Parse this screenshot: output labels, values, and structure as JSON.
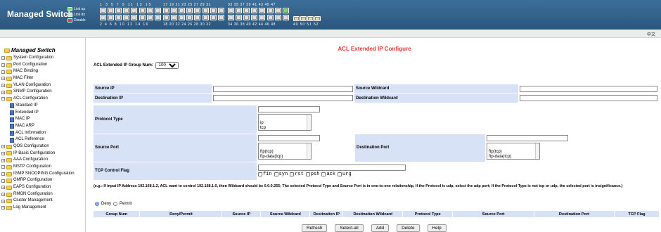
{
  "header": {
    "title": "Managed Switch",
    "legend": [
      {
        "label": "Link up",
        "color": "#7fd36f"
      },
      {
        "label": "Link dn",
        "color": "#dddddd"
      },
      {
        "label": "Disable",
        "color": "#e23b3b"
      }
    ],
    "top_numbers": [
      "1 3 5 7 9 11 13 15",
      "17 19 21 23 25 27 29 31",
      "33 35 37 39 41 43 45 47"
    ],
    "bottom_numbers": [
      "2 4 6 8 10 12 14 16",
      "18 20 22 24 26 28 30 32",
      "34 36 38 40 42 44 46 48",
      "49 50 51 52"
    ],
    "language": "中文"
  },
  "sidebar": {
    "title": "Managed Switch",
    "items": [
      {
        "label": "System Configuration",
        "type": "folder"
      },
      {
        "label": "Port Configuration",
        "type": "folder"
      },
      {
        "label": "MAC Binding",
        "type": "folder"
      },
      {
        "label": "MAC Filter",
        "type": "folder"
      },
      {
        "label": "VLAN Configuration",
        "type": "folder"
      },
      {
        "label": "SNMP Configuration",
        "type": "folder"
      },
      {
        "label": "ACL Configuration",
        "type": "folder-open"
      },
      {
        "label": "Standard IP",
        "type": "page"
      },
      {
        "label": "Extended IP",
        "type": "page"
      },
      {
        "label": "MAC IP",
        "type": "page"
      },
      {
        "label": "MAC ARP",
        "type": "page"
      },
      {
        "label": "ACL Information",
        "type": "page"
      },
      {
        "label": "ACL Reference",
        "type": "page"
      },
      {
        "label": "QOS Configuration",
        "type": "folder"
      },
      {
        "label": "IP Basic Configuration",
        "type": "folder"
      },
      {
        "label": "AAA Configuration",
        "type": "folder"
      },
      {
        "label": "MSTP Configuration",
        "type": "folder"
      },
      {
        "label": "IGMP SNOOPING Configuration",
        "type": "folder"
      },
      {
        "label": "GMRP Configuration",
        "type": "folder"
      },
      {
        "label": "EAPS Configuration",
        "type": "folder"
      },
      {
        "label": "RMON Configuration",
        "type": "folder"
      },
      {
        "label": "Cluster Management",
        "type": "folder"
      },
      {
        "label": "Log Management",
        "type": "folder"
      }
    ]
  },
  "main": {
    "title": "ACL Extended IP Configure",
    "group_num_label": "ACL Extended IP Group Num:",
    "group_num_value": "100",
    "source_ip_label": "Source IP",
    "source_wildcard_label": "Source Wildcard",
    "dest_ip_label": "Destination IP",
    "dest_wildcard_label": "Destination Wildcard",
    "protocol_type_label": "Protocol Type",
    "protocol_options": [
      "ip",
      "tcp"
    ],
    "source_port_label": "Source Port",
    "source_port_options": [
      "ftp(tcp)",
      "ftp-data(tcp)"
    ],
    "dest_port_label": "Destination Port",
    "dest_port_options": [
      "ftp(tcp)",
      "ftp-data(tcp)"
    ],
    "tcp_flag_label": "TCP Control Flag",
    "tcp_flags": [
      "fin",
      "syn",
      "rst",
      "psh",
      "ack",
      "urg"
    ],
    "note": "(e.g.: If input IP Address 192.168.1.2, ACL want to control 192.168.1.0, then Wildcard should be 0.0.0.255; The selected Protocol Type and Source Port is in one-to-one relationship, If the Protocol is udp, select the udp port; If the Protocol Type is not tcp or udp, the selected port is insignificance.)",
    "deny_label": "Deny",
    "permit_label": "Permit",
    "columns": [
      "Group Num",
      "Deny/Permit",
      "Source IP",
      "Source Wildcard",
      "Destination IP",
      "Destination Wildcard",
      "Protocol Type",
      "Source Port",
      "Destination Port",
      "TCP Flag"
    ],
    "buttons": [
      "Refresh",
      "Select-all",
      "Add",
      "Delete",
      "Help"
    ]
  }
}
